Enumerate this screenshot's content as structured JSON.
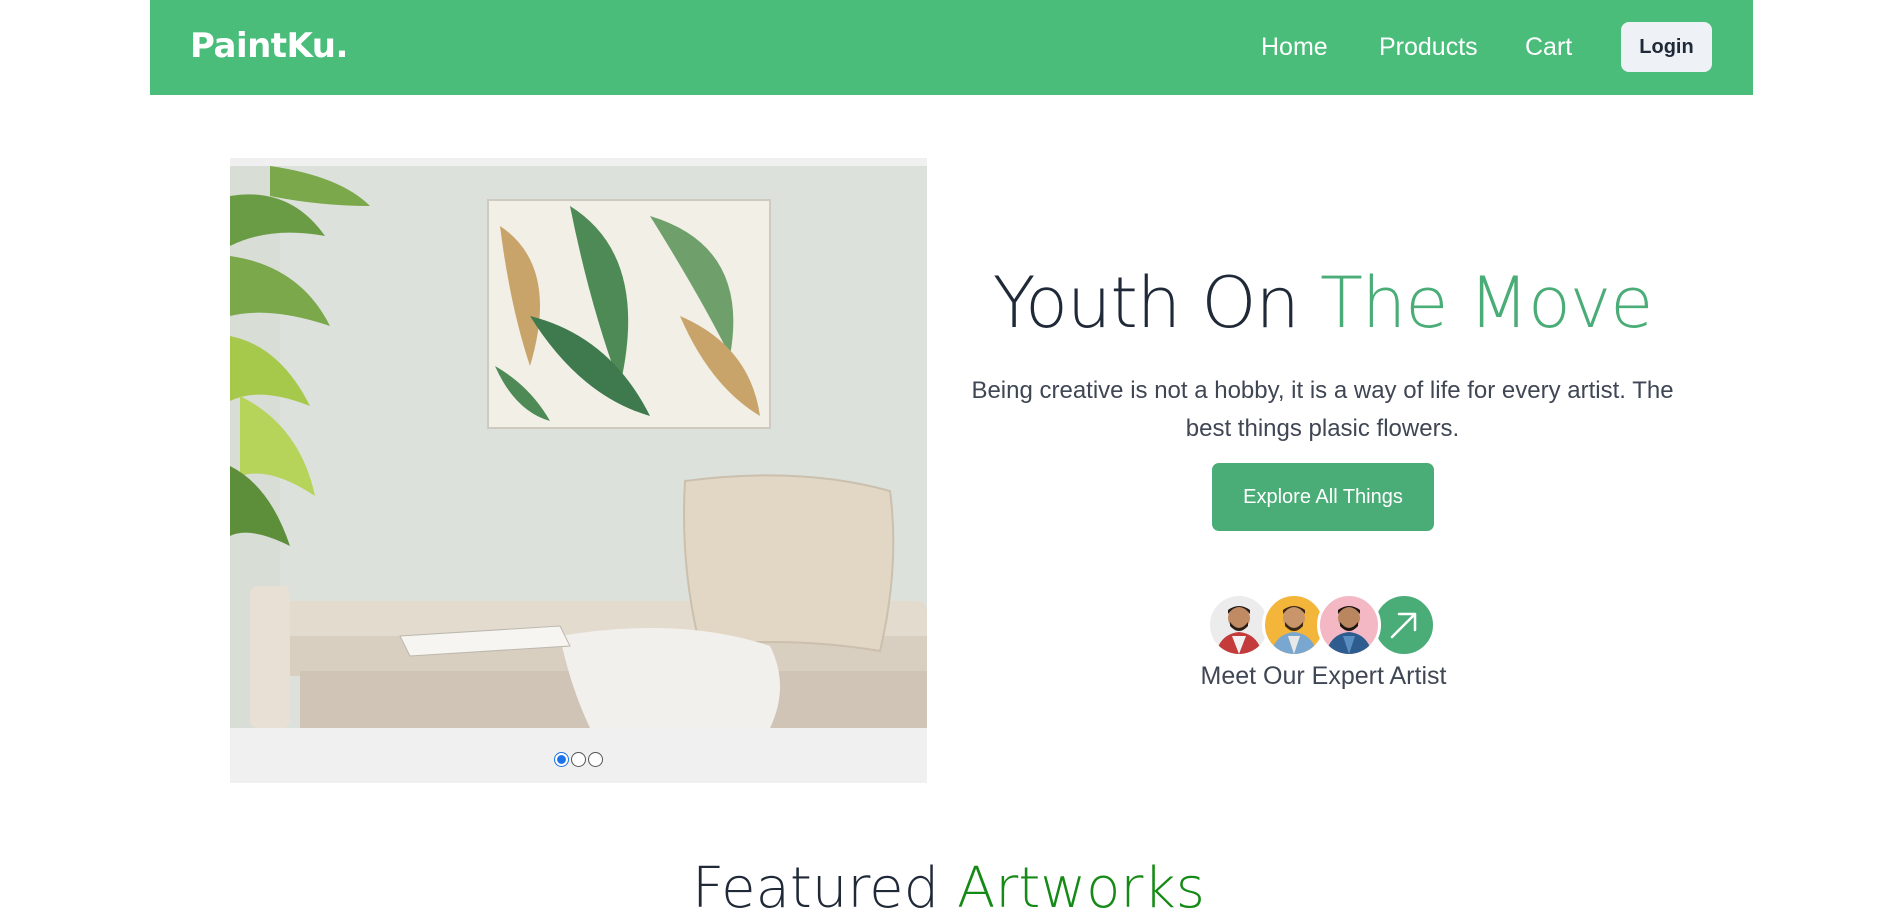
{
  "navbar": {
    "brand": "PaintKu.",
    "links": [
      "Home",
      "Products",
      "Cart"
    ],
    "login_label": "Login",
    "background_color": "#4abd7a"
  },
  "carousel": {
    "image_description_icon": "living-room-painting-image",
    "slide_count": 3,
    "active_slide": 1
  },
  "hero": {
    "title_part1": "Youth On ",
    "title_part2": "The Move",
    "description": "Being creative is not a hobby, it is a way of life for every artist. The best things plasic flowers.",
    "cta_label": "Explore All Things",
    "accent_color": "#4aad78"
  },
  "artists": {
    "label": "Meet Our Expert Artist",
    "arrow_icon": "arrow-up-right-icon"
  },
  "featured": {
    "title_part1": "Featured ",
    "title_part2": "Artworks",
    "accent_color": "#168a16"
  }
}
